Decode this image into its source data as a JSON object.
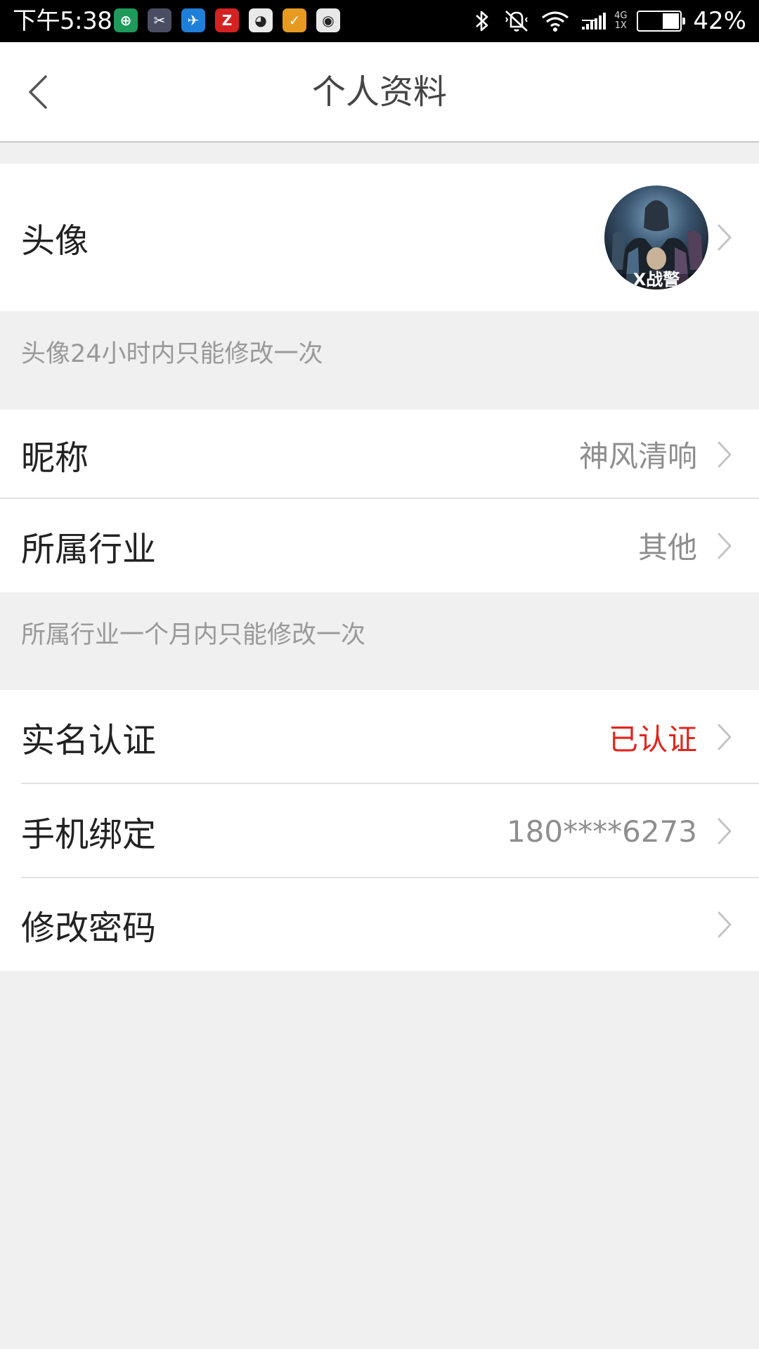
{
  "status_bar": {
    "time": "下午5:38",
    "apps": [
      {
        "name": "shield-app-icon",
        "glyph": "⊕",
        "color": "#1e9a5b"
      },
      {
        "name": "scissors-app-icon",
        "glyph": "✂",
        "color": "#4a4e63"
      },
      {
        "name": "bird-app-icon",
        "glyph": "✈",
        "color": "#1f7fd8"
      },
      {
        "name": "z-app-icon",
        "glyph": "Z",
        "color": "#d42222"
      },
      {
        "name": "penguin-app-icon",
        "glyph": "◕",
        "color": "#e9e9e9"
      },
      {
        "name": "broom-app-icon",
        "glyph": "✓",
        "color": "#e79a21"
      },
      {
        "name": "browser-app-icon",
        "glyph": "◉",
        "color": "#e8e8e8"
      }
    ],
    "network_label": "4G",
    "network_sub": "1X",
    "battery_level": 0.42,
    "battery_text": "42%"
  },
  "header": {
    "title": "个人资料"
  },
  "sections": {
    "avatar_row": {
      "label": "头像",
      "avatar_caption": "X战警"
    },
    "avatar_hint": "头像24小时内只能修改一次",
    "nickname_row": {
      "label": "昵称",
      "value": "神风清响"
    },
    "industry_row": {
      "label": "所属行业",
      "value": "其他"
    },
    "industry_hint": "所属行业一个月内只能修改一次",
    "realname_row": {
      "label": "实名认证",
      "value": "已认证",
      "value_color": "#e0261e"
    },
    "phone_row": {
      "label": "手机绑定",
      "value": "180****6273"
    },
    "password_row": {
      "label": "修改密码"
    }
  }
}
